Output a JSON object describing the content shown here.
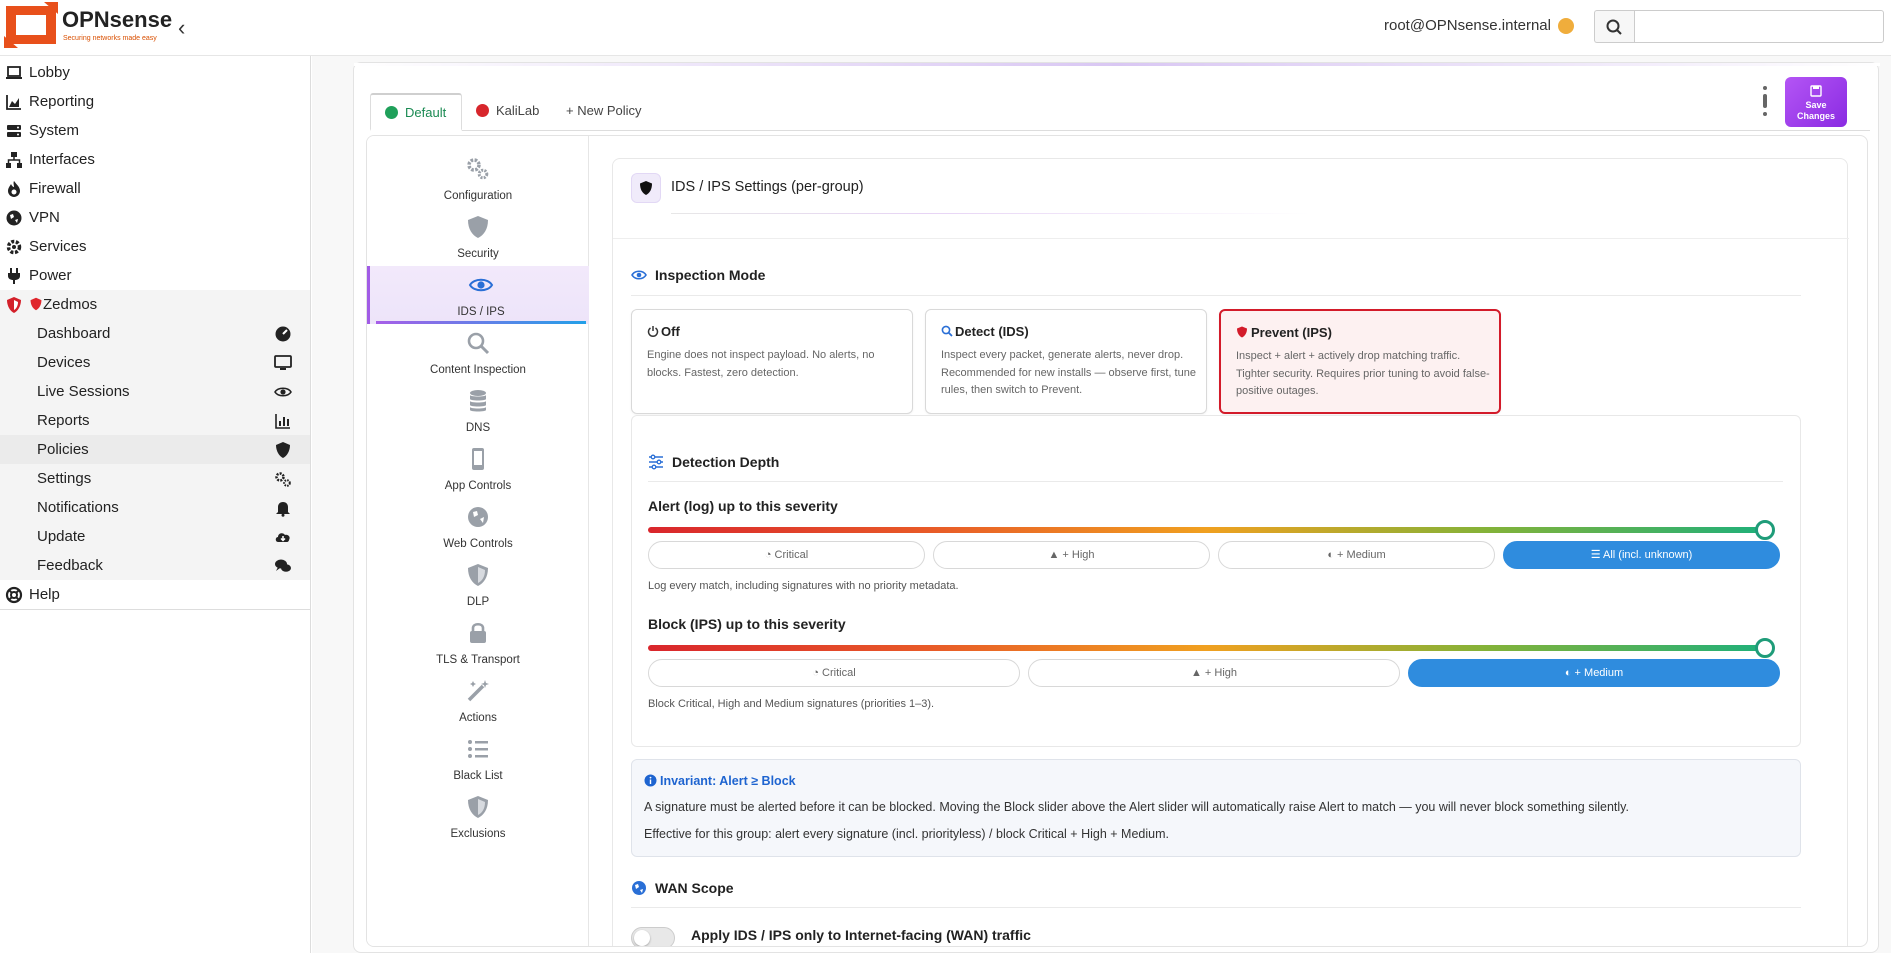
{
  "brand": {
    "name": "OPNsense",
    "tagline": "Securing networks made easy"
  },
  "header": {
    "user": "root@OPNsense.internal",
    "search_placeholder": ""
  },
  "sidebar": {
    "items": [
      {
        "label": "Lobby",
        "icon": "laptop-icon"
      },
      {
        "label": "Reporting",
        "icon": "chart-area-icon"
      },
      {
        "label": "System",
        "icon": "server-icon"
      },
      {
        "label": "Interfaces",
        "icon": "sitemap-icon"
      },
      {
        "label": "Firewall",
        "icon": "fire-icon"
      },
      {
        "label": "VPN",
        "icon": "globe-icon"
      },
      {
        "label": "Services",
        "icon": "gear-icon"
      },
      {
        "label": "Power",
        "icon": "plug-icon"
      },
      {
        "label": "Zedmos",
        "icon": "shield-icon"
      }
    ],
    "zedmos_items": [
      {
        "label": "Dashboard",
        "icon": "gauge-icon"
      },
      {
        "label": "Devices",
        "icon": "desktop-icon"
      },
      {
        "label": "Live Sessions",
        "icon": "eye-icon"
      },
      {
        "label": "Reports",
        "icon": "bar-chart-icon"
      },
      {
        "label": "Policies",
        "icon": "shield-icon"
      },
      {
        "label": "Settings",
        "icon": "gears-icon"
      },
      {
        "label": "Notifications",
        "icon": "bell-icon"
      },
      {
        "label": "Update",
        "icon": "cloud-download-icon"
      },
      {
        "label": "Feedback",
        "icon": "comments-icon"
      }
    ],
    "help": "Help"
  },
  "policy_tabs": {
    "default": "Default",
    "kalilab": "KaliLab",
    "new": "+ New Policy"
  },
  "save": {
    "line1": "Save",
    "line2": "Changes"
  },
  "leftnav": [
    "Configuration",
    "Security",
    "IDS / IPS",
    "Content Inspection",
    "DNS",
    "App Controls",
    "Web Controls",
    "DLP",
    "TLS & Transport",
    "Actions",
    "Black List",
    "Exclusions"
  ],
  "content": {
    "title": "IDS / IPS Settings (per-group)",
    "inspection": {
      "heading": "Inspection Mode",
      "modes": [
        {
          "title": "Off",
          "desc": "Engine does not inspect payload. No alerts, no blocks. Fastest, zero detection."
        },
        {
          "title": "Detect (IDS)",
          "desc": "Inspect every packet, generate alerts, never drop. Recommended for new installs — observe first, tune rules, then switch to Prevent."
        },
        {
          "title": "Prevent (IPS)",
          "desc": "Inspect + alert + actively drop matching traffic. Tighter security. Requires prior tuning to avoid false-positive outages."
        }
      ],
      "selected": "Prevent (IPS)"
    },
    "depth": {
      "heading": "Detection Depth",
      "alert": {
        "label": "Alert (log) up to this severity",
        "options": [
          "Critical",
          "+ High",
          "+ Medium",
          "All (incl. unknown)"
        ],
        "selected_index": 3,
        "level": 1.0,
        "help": "Log every match, including signatures with no priority metadata."
      },
      "block": {
        "label": "Block (IPS) up to this severity",
        "options": [
          "Critical",
          "+ High",
          "+ Medium"
        ],
        "selected_index": 2,
        "level": 1.0,
        "help": "Block Critical, High and Medium signatures (priorities 1–3)."
      }
    },
    "invariant": {
      "title": "Invariant: Alert ≥ Block",
      "body": "A signature must be alerted before it can be blocked. Moving the Block slider above the Alert slider will automatically raise Alert to match — you will never block something silently.",
      "effective": "Effective for this group: alert every signature (incl. priorityless) / block Critical + High + Medium."
    },
    "wan": {
      "heading": "WAN Scope",
      "toggle_label": "Apply IDS / IPS only to Internet-facing (WAN) traffic",
      "enabled": false
    }
  },
  "colors": {
    "accent_purple": "#a15ce6",
    "selected_blue": "#2f8cde",
    "prevent_red": "#d31b2a",
    "logo_orange": "#e8501b"
  }
}
